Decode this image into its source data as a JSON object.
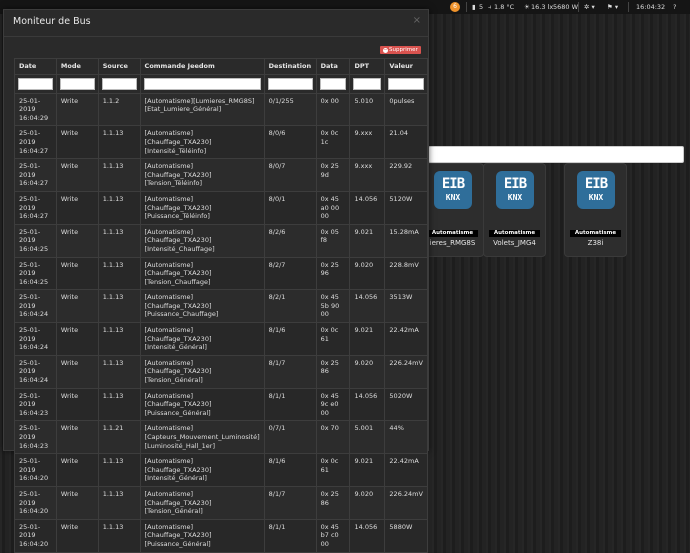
{
  "navbar": {
    "badge": "6",
    "stat1": "5",
    "temp": "1.8 °C",
    "lux": "16.3 lx",
    "power": "5680 W",
    "time": "16:04:32"
  },
  "tiles": [
    {
      "category": "Automatisme",
      "name": "ieres_RMG8S"
    },
    {
      "category": "Automatisme",
      "name": "Volets_JMG4"
    },
    {
      "category": "Automatisme",
      "name": "Z38i"
    }
  ],
  "tile_logo": {
    "line1": "EIB",
    "line2": "KNX"
  },
  "modal": {
    "title": "Moniteur de Bus",
    "close": "×",
    "delete_button": "Supprimer",
    "columns": [
      "Date",
      "Mode",
      "Source",
      "Commande Jeedom",
      "Destination",
      "Data",
      "DPT",
      "Valeur"
    ],
    "rows": [
      [
        "25-01-2019 16:04:29",
        "Write",
        "1.1.2",
        "[Automatisme][Lumieres_RMG8S][Etat_Lumiere_Général]",
        "0/1/255",
        "0x 00",
        "5.010",
        "0pulses"
      ],
      [
        "25-01-2019 16:04:27",
        "Write",
        "1.1.13",
        "[Automatisme][Chauffage_TXA230][Intensité_Téléinfo]",
        "8/0/6",
        "0x 0c 1c",
        "9.xxx",
        "21.04"
      ],
      [
        "25-01-2019 16:04:27",
        "Write",
        "1.1.13",
        "[Automatisme][Chauffage_TXA230][Tension_Téléinfo]",
        "8/0/7",
        "0x 25 9d",
        "9.xxx",
        "229.92"
      ],
      [
        "25-01-2019 16:04:27",
        "Write",
        "1.1.13",
        "[Automatisme][Chauffage_TXA230][Puissance_Téléinfo]",
        "8/0/1",
        "0x 45 a0 00 00",
        "14.056",
        "5120W"
      ],
      [
        "25-01-2019 16:04:25",
        "Write",
        "1.1.13",
        "[Automatisme][Chauffage_TXA230][Intensité_Chauffage]",
        "8/2/6",
        "0x 05 f8",
        "9.021",
        "15.28mA"
      ],
      [
        "25-01-2019 16:04:25",
        "Write",
        "1.1.13",
        "[Automatisme][Chauffage_TXA230][Tension_Chauffage]",
        "8/2/7",
        "0x 25 96",
        "9.020",
        "228.8mV"
      ],
      [
        "25-01-2019 16:04:24",
        "Write",
        "1.1.13",
        "[Automatisme][Chauffage_TXA230][Puissance_Chauffage]",
        "8/2/1",
        "0x 45 5b 90 00",
        "14.056",
        "3513W"
      ],
      [
        "25-01-2019 16:04:24",
        "Write",
        "1.1.13",
        "[Automatisme][Chauffage_TXA230][Intensité_Général]",
        "8/1/6",
        "0x 0c 61",
        "9.021",
        "22.42mA"
      ],
      [
        "25-01-2019 16:04:24",
        "Write",
        "1.1.13",
        "[Automatisme][Chauffage_TXA230][Tension_Général]",
        "8/1/7",
        "0x 25 86",
        "9.020",
        "226.24mV"
      ],
      [
        "25-01-2019 16:04:23",
        "Write",
        "1.1.13",
        "[Automatisme][Chauffage_TXA230][Puissance_Général]",
        "8/1/1",
        "0x 45 9c e0 00",
        "14.056",
        "5020W"
      ],
      [
        "25-01-2019 16:04:23",
        "Write",
        "1.1.21",
        "[Automatisme][Capteurs_Mouvement_Luminosité][Luminosité_Hall_1er]",
        "0/7/1",
        "0x 70",
        "5.001",
        "44%"
      ],
      [
        "25-01-2019 16:04:20",
        "Write",
        "1.1.13",
        "[Automatisme][Chauffage_TXA230][Intensité_Général]",
        "8/1/6",
        "0x 0c 61",
        "9.021",
        "22.42mA"
      ],
      [
        "25-01-2019 16:04:20",
        "Write",
        "1.1.13",
        "[Automatisme][Chauffage_TXA230][Tension_Général]",
        "8/1/7",
        "0x 25 86",
        "9.020",
        "226.24mV"
      ],
      [
        "25-01-2019 16:04:20",
        "Write",
        "1.1.13",
        "[Automatisme][Chauffage_TXA230][Puissance_Général]",
        "8/1/1",
        "0x 45 b7 c0 00",
        "14.056",
        "5880W"
      ]
    ]
  }
}
